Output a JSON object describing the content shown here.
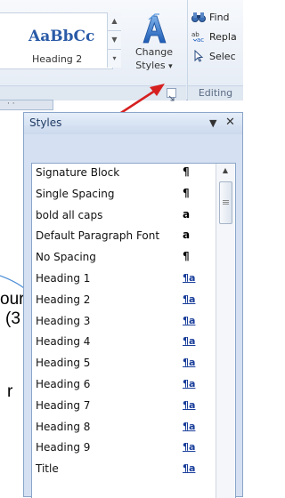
{
  "ribbon": {
    "style_gallery": {
      "preview_text": "AaBbCc",
      "style_name": "Heading 2",
      "scroll_up_glyph": "▲",
      "scroll_down_glyph": "▼",
      "more_glyph": "▾"
    },
    "change_styles": {
      "label_line1": "Change",
      "label_line2": "Styles",
      "dropdown_glyph": "▾",
      "icon": "change-styles-icon"
    },
    "editing": {
      "find_label": "Find",
      "replace_label": "Repla",
      "select_label": "Selec",
      "group_label": "Editing",
      "dialog_launcher_glyph": "↘"
    },
    "ruler_glyph": "· ·"
  },
  "document": {
    "fragments": [
      "our",
      "(3",
      "r"
    ]
  },
  "styles_pane": {
    "title": "Styles",
    "dropdown_glyph": "▼",
    "close_glyph": "✕",
    "items": [
      {
        "name": "Signature Block",
        "type": "¶",
        "kind": "paragraph"
      },
      {
        "name": "Single Spacing",
        "type": "¶",
        "kind": "paragraph"
      },
      {
        "name": "bold all caps",
        "type": "a",
        "kind": "character"
      },
      {
        "name": "Default Paragraph Font",
        "type": "a",
        "kind": "character"
      },
      {
        "name": "No Spacing",
        "type": "¶",
        "kind": "paragraph"
      },
      {
        "name": "Heading 1",
        "type": "¶a",
        "kind": "linked"
      },
      {
        "name": "Heading 2",
        "type": "¶a",
        "kind": "linked"
      },
      {
        "name": "Heading 3",
        "type": "¶a",
        "kind": "linked"
      },
      {
        "name": "Heading 4",
        "type": "¶a",
        "kind": "linked"
      },
      {
        "name": "Heading 5",
        "type": "¶a",
        "kind": "linked"
      },
      {
        "name": "Heading 6",
        "type": "¶a",
        "kind": "linked"
      },
      {
        "name": "Heading 7",
        "type": "¶a",
        "kind": "linked"
      },
      {
        "name": "Heading 8",
        "type": "¶a",
        "kind": "linked"
      },
      {
        "name": "Heading 9",
        "type": "¶a",
        "kind": "linked"
      },
      {
        "name": "Title",
        "type": "¶a",
        "kind": "linked"
      }
    ],
    "scroll_up_glyph": "▲"
  },
  "annotation": {
    "arrow_color": "#d62020",
    "callout_color": "#4f8fd6"
  }
}
